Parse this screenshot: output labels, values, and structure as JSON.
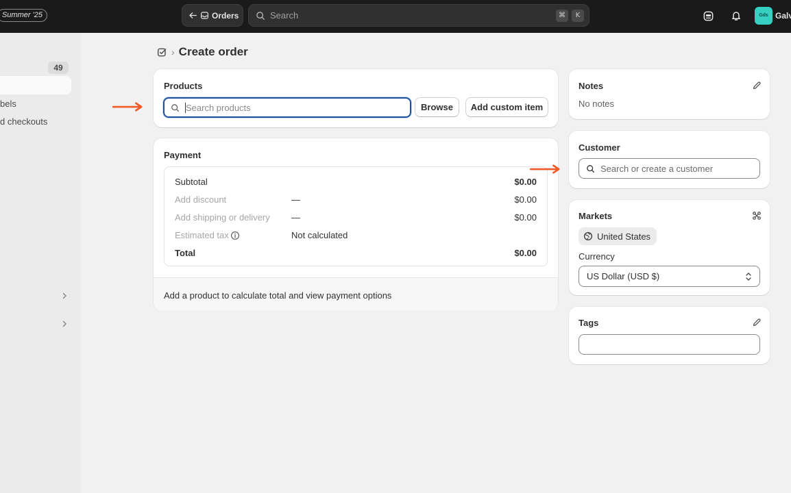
{
  "topbar": {
    "badge": "Summer '25",
    "back_label": "Orders",
    "search_placeholder": "Search",
    "shortcut_keys": [
      "⌘",
      "K"
    ],
    "avatar_initials": "Gds",
    "store_name": "Galv"
  },
  "sidebar": {
    "count_badge": "49",
    "items": [
      "bels",
      "d checkouts"
    ]
  },
  "breadcrumb": {
    "icon": "order-edit-icon",
    "title": "Create order"
  },
  "products": {
    "title": "Products",
    "search_placeholder": "Search products",
    "browse_label": "Browse",
    "custom_item_label": "Add custom item"
  },
  "payment": {
    "title": "Payment",
    "rows": [
      {
        "label": "Subtotal",
        "mid": "",
        "amount": "$0.00"
      },
      {
        "label": "Add discount",
        "mid": "—",
        "amount": "$0.00"
      },
      {
        "label": "Add shipping or delivery",
        "mid": "—",
        "amount": "$0.00"
      },
      {
        "label": "Estimated tax",
        "mid": "Not calculated",
        "amount": ""
      },
      {
        "label": "Total",
        "mid": "",
        "amount": "$0.00"
      }
    ],
    "footer": "Add a product to calculate total and view payment options"
  },
  "notes": {
    "title": "Notes",
    "body": "No notes"
  },
  "customer": {
    "title": "Customer",
    "search_placeholder": "Search or create a customer"
  },
  "markets": {
    "title": "Markets",
    "market_name": "United States",
    "currency_label": "Currency",
    "currency_value": "US Dollar (USD $)"
  },
  "tags": {
    "title": "Tags",
    "value": ""
  },
  "colors": {
    "topbar": "#1a1a1a",
    "focus": "#1f5199",
    "arrow": "#ef5a26",
    "avatar": "#36d0c2"
  }
}
